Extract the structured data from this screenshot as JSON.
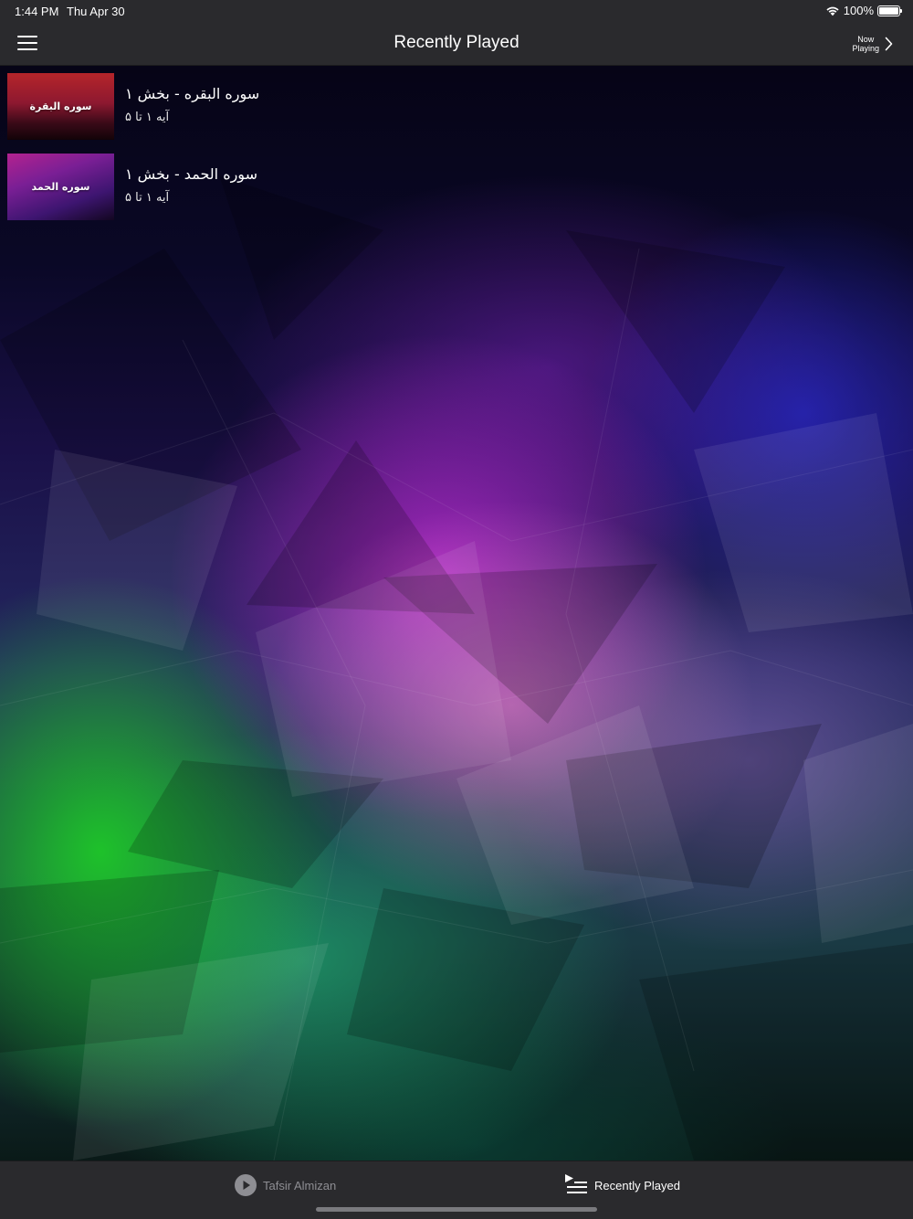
{
  "status_bar": {
    "time": "1:44 PM",
    "date": "Thu Apr 30",
    "battery": "100%",
    "icons": [
      "wifi-icon",
      "battery-icon"
    ]
  },
  "nav": {
    "title": "Recently Played",
    "menu_icon": "hamburger-menu-icon",
    "now_playing_line1": "Now",
    "now_playing_line2": "Playing",
    "now_playing_icon": "chevron-right-icon"
  },
  "items": [
    {
      "thumb_label": "سوره البقرة",
      "title": "سوره البقره - بخش ۱",
      "subtitle": "آیه ۱ تا ۵"
    },
    {
      "thumb_label": "سوره الحمد",
      "title": "سوره الحمد - بخش ۱",
      "subtitle": "آیه ۱ تا ۵"
    }
  ],
  "tabs": [
    {
      "label": "Tafsir Almizan",
      "icon": "play-circle-icon",
      "selected": false
    },
    {
      "label": "Recently Played",
      "icon": "playlist-icon",
      "selected": true
    }
  ],
  "colors": {
    "bar_background": "#2a2a2d",
    "tab_inactive": "#8e8e93",
    "tab_active": "#ffffff"
  }
}
